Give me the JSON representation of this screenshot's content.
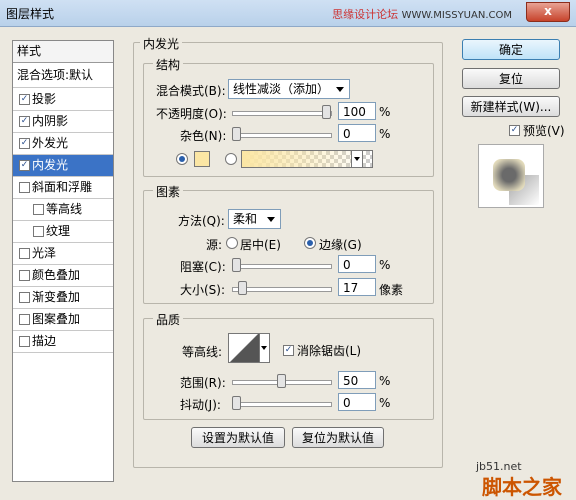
{
  "window": {
    "title": "图层样式",
    "watermark": "思缘设计论坛",
    "watermark_site": "WWW.MISSYUAN.COM",
    "close_label": "x"
  },
  "sidebar": {
    "header": "样式",
    "blend_default": "混合选项:默认",
    "items": [
      {
        "label": "投影",
        "checked": true
      },
      {
        "label": "内阴影",
        "checked": true
      },
      {
        "label": "外发光",
        "checked": true
      },
      {
        "label": "内发光",
        "checked": true,
        "selected": true
      },
      {
        "label": "斜面和浮雕",
        "checked": false
      },
      {
        "label": "等高线",
        "checked": false,
        "sub": true
      },
      {
        "label": "纹理",
        "checked": false,
        "sub": true
      },
      {
        "label": "光泽",
        "checked": false
      },
      {
        "label": "颜色叠加",
        "checked": false
      },
      {
        "label": "渐变叠加",
        "checked": false
      },
      {
        "label": "图案叠加",
        "checked": false
      },
      {
        "label": "描边",
        "checked": false
      }
    ]
  },
  "inner_glow": {
    "title": "内发光",
    "structure": {
      "title": "结构",
      "blend_mode_label": "混合模式(B):",
      "blend_mode_value": "线性减淡（添加）",
      "opacity_label": "不透明度(O):",
      "opacity_value": "100",
      "opacity_unit": "%",
      "opacity_level": 1.0,
      "noise_label": "杂色(N):",
      "noise_value": "0",
      "noise_unit": "%",
      "noise_level": 0.0,
      "glow_color": "#fbe6a4"
    },
    "elements": {
      "title": "图素",
      "method_label": "方法(Q):",
      "method_value": "柔和",
      "source_label": "源:",
      "source_center": "居中(E)",
      "source_edge": "边缘(G)",
      "choke_label": "阻塞(C):",
      "choke_value": "0",
      "choke_unit": "%",
      "choke_level": 0.0,
      "size_label": "大小(S):",
      "size_value": "17",
      "size_unit": "像素",
      "size_level": 0.068
    },
    "quality": {
      "title": "品质",
      "contour_label": "等高线:",
      "antialias_label": "消除锯齿(L)",
      "antialias_checked": true,
      "range_label": "范围(R):",
      "range_value": "50",
      "range_unit": "%",
      "range_level": 0.5,
      "jitter_label": "抖动(J):",
      "jitter_value": "0",
      "jitter_unit": "%",
      "jitter_level": 0.0
    },
    "make_default": "设置为默认值",
    "reset_default": "复位为默认值"
  },
  "buttons": {
    "ok": "确定",
    "reset": "复位",
    "new_style": "新建样式(W)...",
    "preview": "预览(V)",
    "preview_checked": true
  },
  "footer_watermark": {
    "site": "jb51.net",
    "name": "脚本之家"
  }
}
